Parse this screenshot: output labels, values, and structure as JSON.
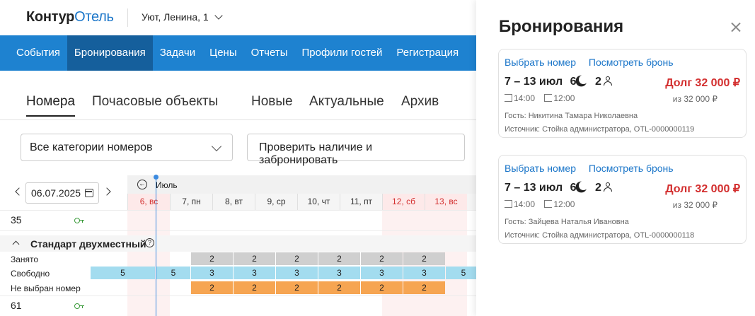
{
  "header": {
    "logo_part1": "Контур",
    "logo_part2": "Отель",
    "hotel_name": "Уют, Ленина, 1"
  },
  "nav": {
    "items": [
      "События",
      "Бронирования",
      "Задачи",
      "Цены",
      "Отчеты",
      "Профили гостей",
      "Регистрация"
    ],
    "active_index": 1
  },
  "tabs": {
    "left": [
      "Номера",
      "Почасовые объекты"
    ],
    "right": [
      "Новые",
      "Актуальные",
      "Архив"
    ],
    "active": "Номера"
  },
  "filters": {
    "category_select": "Все категории номеров",
    "check_button": "Проверить наличие и забронировать"
  },
  "calendar": {
    "date_value": "06.07.2025",
    "month": "Июль",
    "days": [
      {
        "label": "6, вс",
        "weekend": true
      },
      {
        "label": "7, пн",
        "weekend": false
      },
      {
        "label": "8, вт",
        "weekend": false
      },
      {
        "label": "9, ср",
        "weekend": false
      },
      {
        "label": "10, чт",
        "weekend": false
      },
      {
        "label": "11, пт",
        "weekend": false
      },
      {
        "label": "12, сб",
        "weekend": true
      },
      {
        "label": "13, вс",
        "weekend": true
      }
    ],
    "room_top": "35",
    "category_title": "Стандарт двухместный",
    "stat_labels": {
      "busy": "Занято",
      "free": "Свободно",
      "no_room": "Не выбран номер"
    },
    "busy_values": [
      "2",
      "2",
      "2",
      "2",
      "2",
      "2"
    ],
    "free_values": [
      "5",
      "5",
      "3",
      "3",
      "3",
      "3",
      "3",
      "3",
      "5"
    ],
    "no_room_values": [
      "2",
      "2",
      "2",
      "2",
      "2",
      "2"
    ],
    "room_bottom": "61"
  },
  "panel": {
    "title": "Бронирования",
    "bookings": [
      {
        "link_select": "Выбрать номер",
        "link_view": "Посмотреть бронь",
        "dates": "7 – 13 июл",
        "nights": "6",
        "guests": "2",
        "debt": "Долг 32 000 ₽",
        "checkin": "14:00",
        "checkout": "12:00",
        "of_total": "из 32 000 ₽",
        "guest": "Гость: Никитина Тамара Николаевна",
        "source": "Источник: Стойка администратора, OTL-0000000119"
      },
      {
        "link_select": "Выбрать номер",
        "link_view": "Посмотреть бронь",
        "dates": "7 – 13 июл",
        "nights": "6",
        "guests": "2",
        "debt": "Долг 32 000 ₽",
        "checkin": "14:00",
        "checkout": "12:00",
        "of_total": "из 32 000 ₽",
        "guest": "Гость: Зайцева Наталья Ивановна",
        "source": "Источник: Стойка администратора, OTL-0000000118"
      }
    ]
  },
  "colors": {
    "nav_bg": "#1e82d0",
    "nav_active": "#155f9c",
    "link": "#1b76c9",
    "debt": "#d32f2f",
    "busy": "#cfcfcf",
    "free": "#a3dcef",
    "no_room": "#f6a552"
  }
}
